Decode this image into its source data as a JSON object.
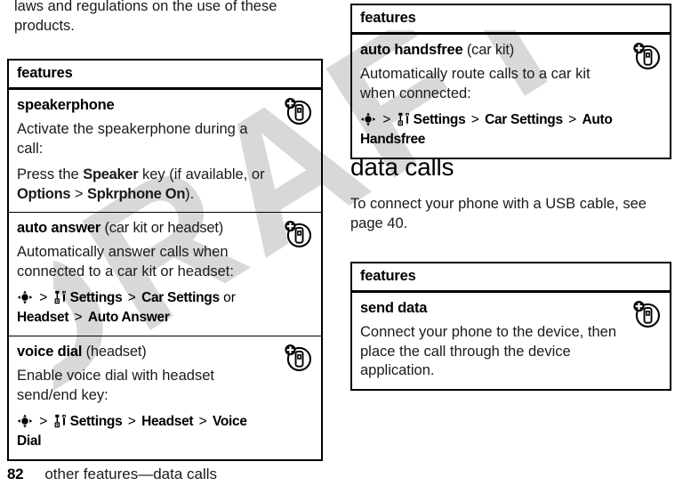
{
  "document": {
    "watermark": "DRAFT",
    "watermark_color": "#d8d8d8",
    "intro_paragraph": "laws and regulations on the use of these products.",
    "footer": {
      "page_number": "82",
      "breadcrumb": "other features—data calls"
    }
  },
  "icons": {
    "nav_key": "navigation-key-icon",
    "settings": "settings-tools-icon",
    "row_badge": "phone-plus-badge-icon",
    "separator": ">"
  },
  "left_column": {
    "table": {
      "header": "features",
      "rows": [
        {
          "title_bold": "speakerphone",
          "title_qualifier": "",
          "blocks": [
            {
              "kind": "text",
              "text": "Activate the speakerphone during a call:"
            },
            {
              "kind": "richtext",
              "parts": [
                {
                  "style": "plain",
                  "text": "Press the "
                },
                {
                  "style": "bold",
                  "text": "Speaker"
                },
                {
                  "style": "plain",
                  "text": " key (if available, or "
                },
                {
                  "style": "bold",
                  "text": "Options"
                },
                {
                  "style": "plain",
                  "text": " > "
                },
                {
                  "style": "bold",
                  "text": "Spkrphone On"
                },
                {
                  "style": "plain",
                  "text": ")."
                }
              ]
            }
          ]
        },
        {
          "title_bold": "auto answer",
          "title_qualifier": "(car kit or headset)",
          "blocks": [
            {
              "kind": "text",
              "text": "Automatically answer calls when connected to a car kit or headset:"
            },
            {
              "kind": "path",
              "segments": [
                {
                  "type": "nav-icon"
                },
                {
                  "type": "sep",
                  "text": ">"
                },
                {
                  "type": "settings-icon"
                },
                {
                  "type": "key",
                  "text": "Settings"
                },
                {
                  "type": "sep",
                  "text": ">"
                },
                {
                  "type": "key",
                  "text": "Car Settings"
                },
                {
                  "type": "lit",
                  "text": "or"
                },
                {
                  "type": "key",
                  "text": "Headset"
                },
                {
                  "type": "sep",
                  "text": ">"
                },
                {
                  "type": "key",
                  "text": "Auto Answer"
                }
              ]
            }
          ]
        },
        {
          "title_bold": "voice dial",
          "title_qualifier": "(headset)",
          "blocks": [
            {
              "kind": "text",
              "text": "Enable voice dial with headset send/end key:"
            },
            {
              "kind": "path",
              "segments": [
                {
                  "type": "nav-icon"
                },
                {
                  "type": "sep",
                  "text": ">"
                },
                {
                  "type": "settings-icon"
                },
                {
                  "type": "key",
                  "text": "Settings"
                },
                {
                  "type": "sep",
                  "text": ">"
                },
                {
                  "type": "key",
                  "text": "Headset"
                },
                {
                  "type": "sep",
                  "text": ">"
                },
                {
                  "type": "key",
                  "text": "Voice Dial"
                }
              ]
            }
          ]
        }
      ]
    }
  },
  "right_column": {
    "table_top": {
      "header": "features",
      "rows": [
        {
          "title_bold": "auto handsfree",
          "title_qualifier": "(car kit)",
          "blocks": [
            {
              "kind": "text",
              "text": "Automatically route calls to a car kit when connected:"
            },
            {
              "kind": "path",
              "segments": [
                {
                  "type": "nav-icon"
                },
                {
                  "type": "sep",
                  "text": ">"
                },
                {
                  "type": "settings-icon"
                },
                {
                  "type": "key",
                  "text": "Settings"
                },
                {
                  "type": "sep",
                  "text": ">"
                },
                {
                  "type": "key",
                  "text": "Car Settings"
                },
                {
                  "type": "sep",
                  "text": ">"
                },
                {
                  "type": "key",
                  "text": "Auto Handsfree"
                }
              ]
            }
          ]
        }
      ]
    },
    "section": {
      "heading": "data calls",
      "paragraph": "To connect your phone with a USB cable, see page 40."
    },
    "table_bottom": {
      "header": "features",
      "rows": [
        {
          "title_bold": "send data",
          "title_qualifier": "",
          "blocks": [
            {
              "kind": "text",
              "text": "Connect your phone to the device, then place the call through the device application."
            }
          ]
        }
      ]
    }
  }
}
